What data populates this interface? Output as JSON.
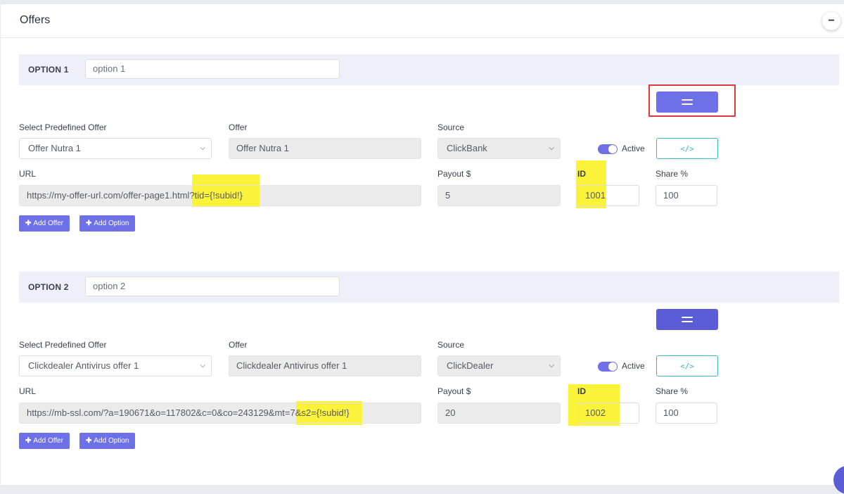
{
  "header": {
    "title": "Offers",
    "collapse_symbol": "−"
  },
  "labels": {
    "predefined": "Select Predefined Offer",
    "offer": "Offer",
    "source": "Source",
    "url": "URL",
    "payout": "Payout $",
    "id": "ID",
    "share": "Share %",
    "active": "Active",
    "add_offer": "Add Offer",
    "add_option": "Add Option",
    "plus": "✚",
    "code_icon": "</>"
  },
  "options": [
    {
      "label": "OPTION 1",
      "name": "option 1",
      "predefined_offer": "Offer Nutra 1",
      "offer": "Offer Nutra 1",
      "source": "ClickBank",
      "active": true,
      "url_prefix": "https://my-offer-url.com/offer-page1.html",
      "url_highlight": "?tid={!subid!}",
      "payout": "5",
      "id": "1001",
      "share": "100"
    },
    {
      "label": "OPTION 2",
      "name": "option 2",
      "predefined_offer": "Clickdealer Antivirus offer 1",
      "offer": "Clickdealer Antivirus offer 1",
      "source": "ClickDealer",
      "active": true,
      "url_prefix": "https://mb-ssl.com/?a=190671&o=117802&c=0&co=243129&mt=",
      "url_highlight": "7&s2={!subid!}",
      "payout": "20",
      "id": "1002",
      "share": "100"
    }
  ],
  "colors": {
    "accent": "#6d70e6",
    "highlight": "#fbf33a",
    "annotation_red": "#e0393b",
    "code_button": "#38b6c9"
  }
}
